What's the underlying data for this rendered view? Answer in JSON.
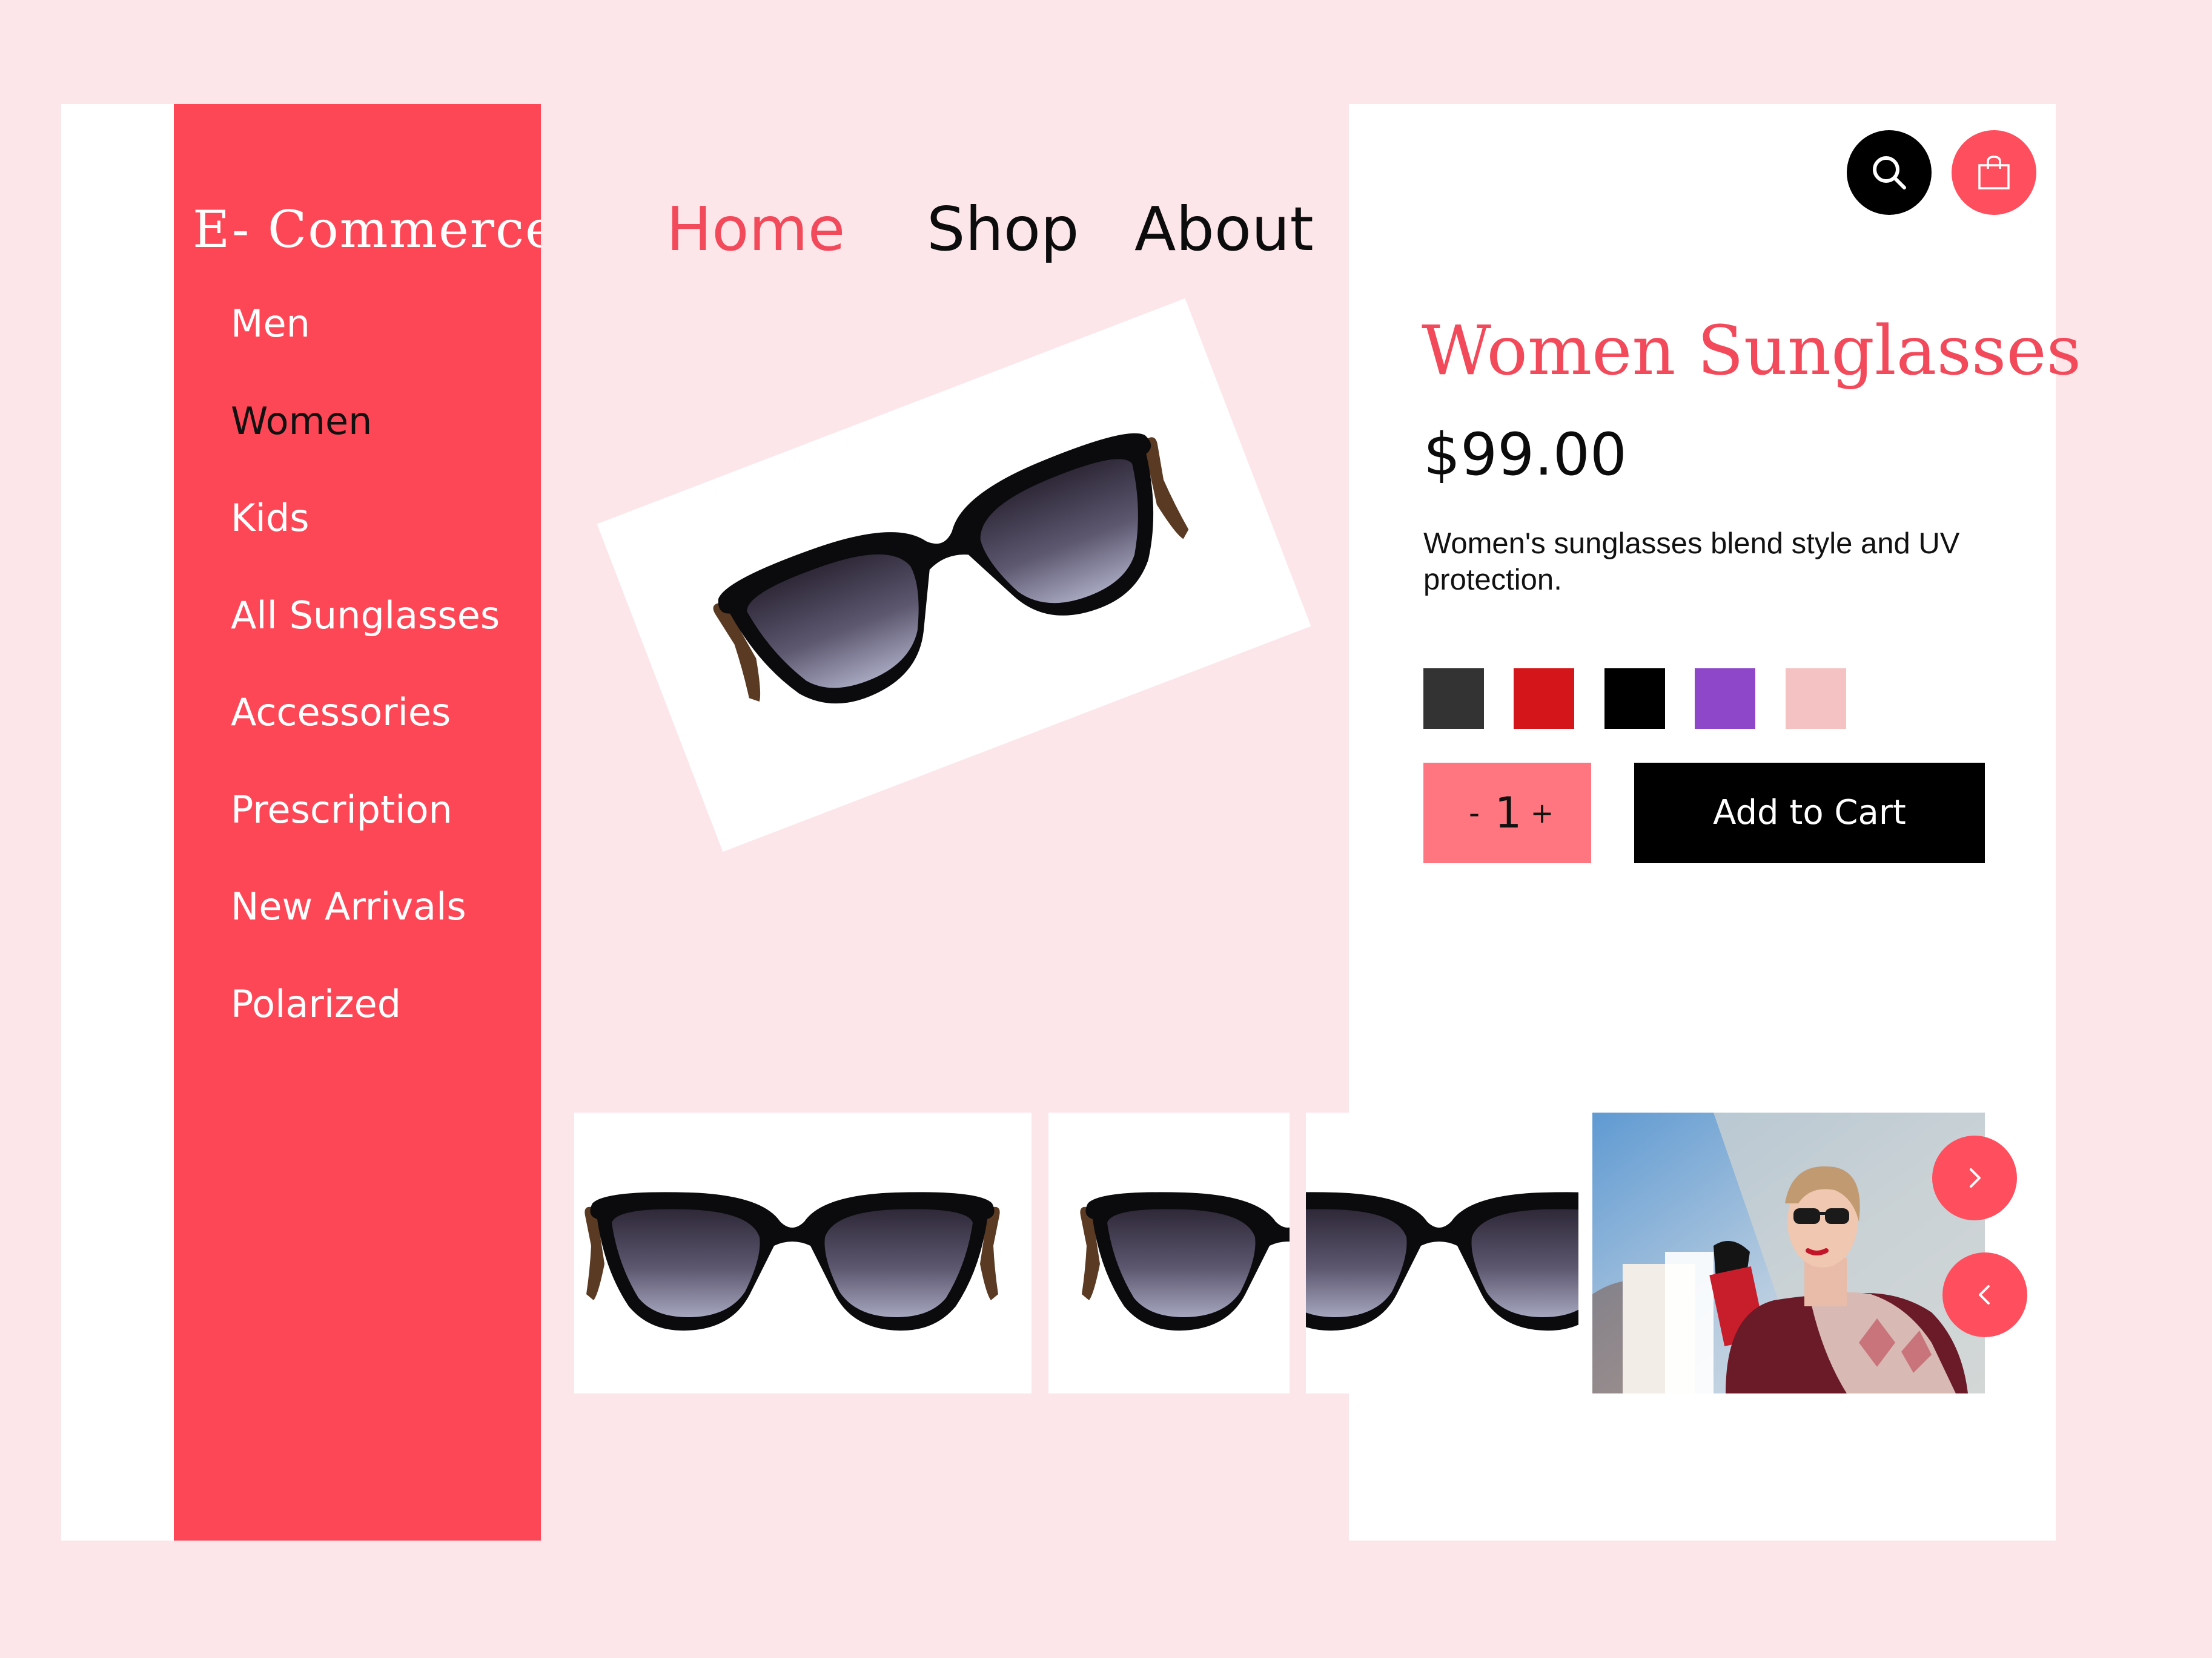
{
  "brand": {
    "name": "E- Commerce"
  },
  "sidebar": {
    "items": [
      {
        "label": "Men",
        "active": false
      },
      {
        "label": "Women",
        "active": true
      },
      {
        "label": "Kids",
        "active": false
      },
      {
        "label": "All Sunglasses",
        "active": false
      },
      {
        "label": "Accessories",
        "active": false
      },
      {
        "label": "Prescription",
        "active": false
      },
      {
        "label": "New Arrivals",
        "active": false
      },
      {
        "label": "Polarized",
        "active": false
      }
    ]
  },
  "nav": {
    "items": [
      {
        "label": "Home",
        "active": true
      },
      {
        "label": "Shop",
        "active": false
      },
      {
        "label": "About",
        "active": false
      }
    ]
  },
  "header_icons": [
    "search-icon",
    "shopping-bag-icon"
  ],
  "product": {
    "title": "Women Sunglasses",
    "price": "$99.00",
    "description": "Women's sunglasses blend style and UV protection.",
    "color_options": [
      "#333333",
      "#d41519",
      "#000000",
      "#8e47c9",
      "#f4c2c2"
    ],
    "quantity": "1",
    "minus_label": "-",
    "plus_label": "+",
    "add_to_cart_label": "Add to Cart"
  },
  "carousel": {
    "next_icon": "chevron-right-icon",
    "prev_icon": "chevron-left-icon"
  },
  "colors": {
    "accent": "#fe4756",
    "nav_active": "#f24a5b",
    "page_background": "#fce6e9",
    "stepper_background": "#ff7680",
    "button_dark": "#000000"
  }
}
